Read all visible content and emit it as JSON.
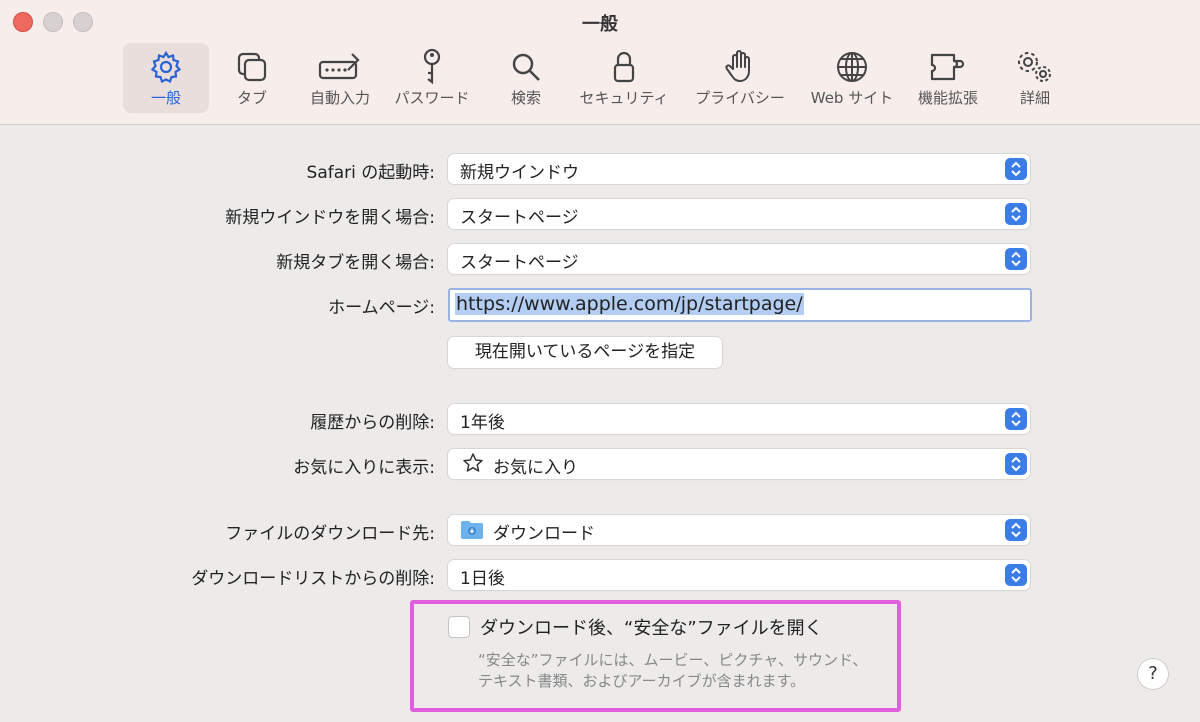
{
  "window": {
    "title": "一般"
  },
  "toolbar": {
    "items": [
      {
        "label": "一般",
        "icon": "gear-icon"
      },
      {
        "label": "タブ",
        "icon": "tabs-icon"
      },
      {
        "label": "自動入力",
        "icon": "autofill-icon"
      },
      {
        "label": "パスワード",
        "icon": "key-icon"
      },
      {
        "label": "検索",
        "icon": "search-icon"
      },
      {
        "label": "セキュリティ",
        "icon": "lock-icon"
      },
      {
        "label": "プライバシー",
        "icon": "hand-icon"
      },
      {
        "label": "Web サイト",
        "icon": "globe-icon"
      },
      {
        "label": "機能拡張",
        "icon": "puzzle-icon"
      },
      {
        "label": "詳細",
        "icon": "gears-icon"
      }
    ],
    "accent": "#2a64d4"
  },
  "form": {
    "startup_label": "Safari の起動時:",
    "startup_value": "新規ウインドウ",
    "new_window_label": "新規ウインドウを開く場合:",
    "new_window_value": "スタートページ",
    "new_tab_label": "新規タブを開く場合:",
    "new_tab_value": "スタートページ",
    "homepage_label": "ホームページ:",
    "homepage_value": "https://www.apple.com/jp/startpage/",
    "set_current_button": "現在開いているページを指定",
    "history_label": "履歴からの削除:",
    "history_value": "1年後",
    "favorites_label": "お気に入りに表示:",
    "favorites_value": "お気に入り",
    "download_location_label": "ファイルのダウンロード先:",
    "download_location_value": "ダウンロード",
    "download_list_label": "ダウンロードリストからの削除:",
    "download_list_value": "1日後",
    "open_safe_label": "ダウンロード後、“安全な”ファイルを開く",
    "open_safe_note": "“安全な”ファイルには、ムービー、ピクチャ、サウンド、テキスト書類、およびアーカイブが含まれます。",
    "help": "?"
  }
}
